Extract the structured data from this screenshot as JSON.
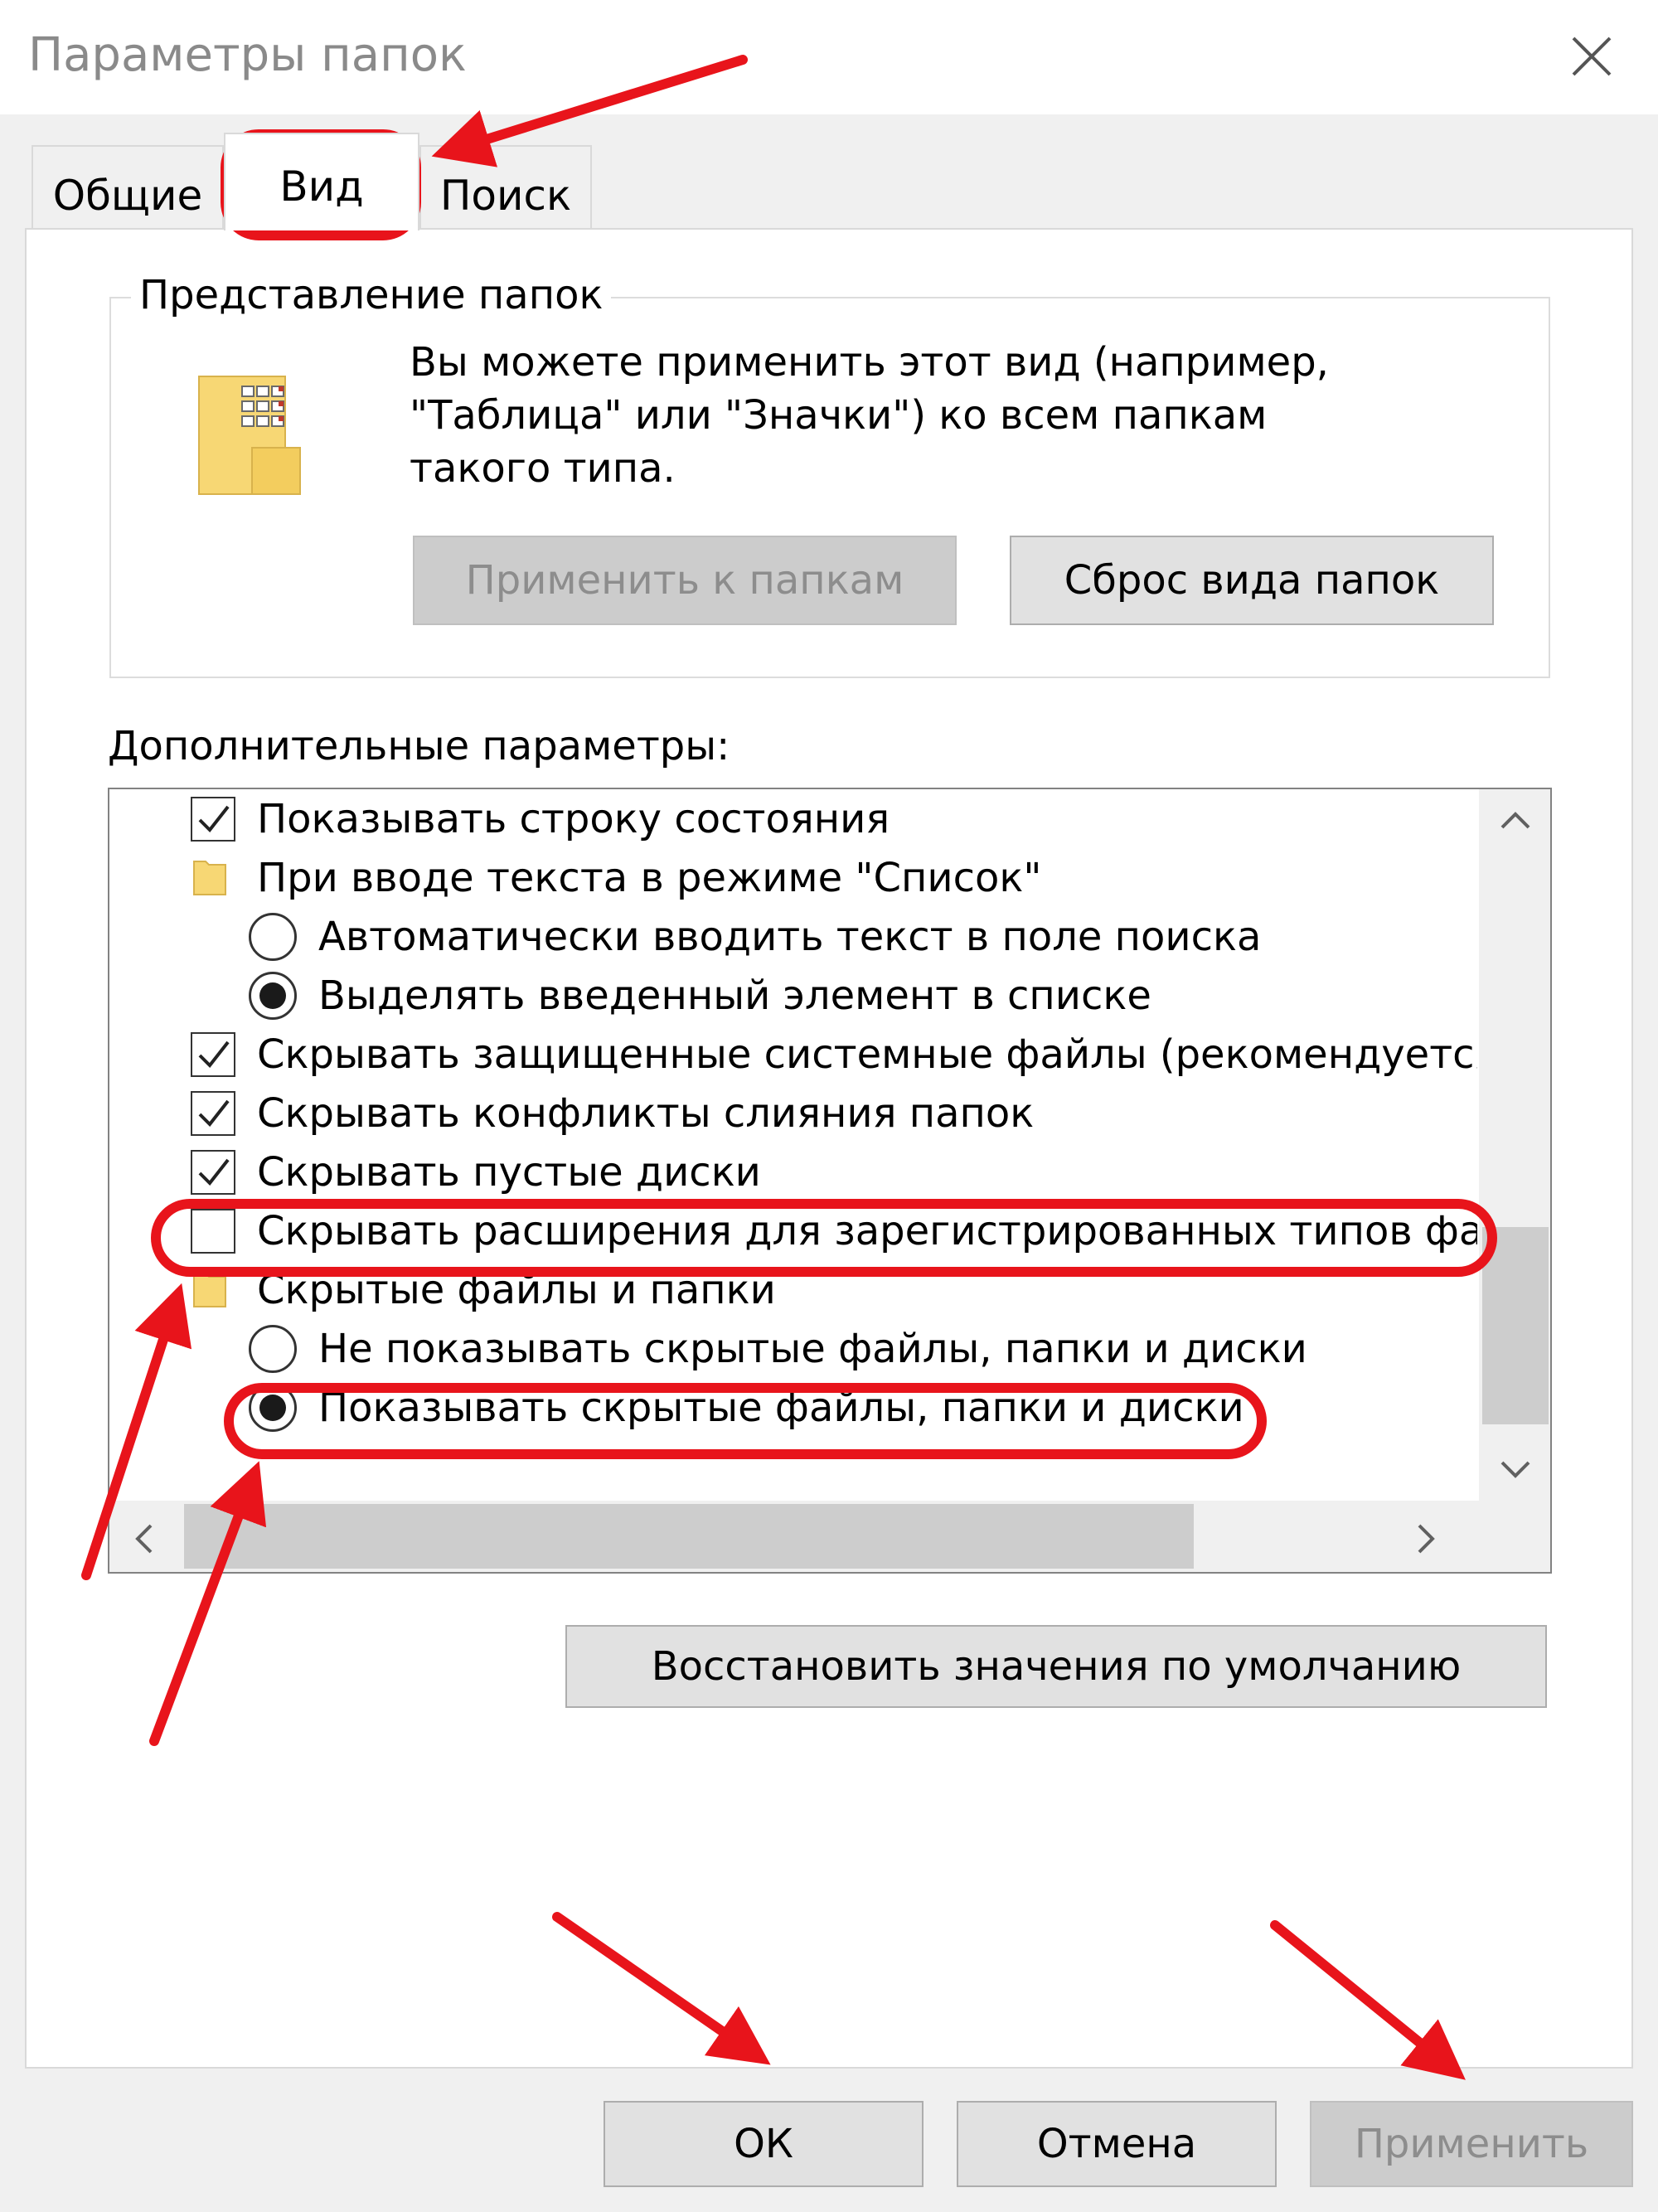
{
  "window": {
    "title": "Параметры папок",
    "close_icon": "close-icon"
  },
  "tabs": [
    {
      "label": "Общие"
    },
    {
      "label": "Вид"
    },
    {
      "label": "Поиск"
    }
  ],
  "folder_views": {
    "legend": "Представление папок",
    "description": "Вы можете применить этот вид (например,\n\"Таблица\" или \"Значки\") ко всем папкам\nтакого типа.",
    "apply_button": "Применить к папкам",
    "reset_button": "Сброс вида папок"
  },
  "advanced": {
    "label": "Дополнительные параметры:",
    "items": [
      {
        "type": "checkbox",
        "checked": true,
        "label": "Показывать строку состояния"
      },
      {
        "type": "folder",
        "label": "При вводе текста в режиме \"Список\""
      },
      {
        "type": "radio",
        "selected": false,
        "label": "Автоматически вводить текст в поле поиска"
      },
      {
        "type": "radio",
        "selected": true,
        "label": "Выделять введенный элемент в списке"
      },
      {
        "type": "checkbox",
        "checked": true,
        "label": "Скрывать защищенные системные файлы (рекомендуется"
      },
      {
        "type": "checkbox",
        "checked": true,
        "label": "Скрывать конфликты слияния папок"
      },
      {
        "type": "checkbox",
        "checked": true,
        "label": "Скрывать пустые диски"
      },
      {
        "type": "checkbox",
        "checked": false,
        "label": "Скрывать расширения для зарегистрированных типов файлов"
      },
      {
        "type": "folder",
        "label": "Скрытые файлы и папки"
      },
      {
        "type": "radio",
        "selected": false,
        "label": "Не показывать скрытые файлы, папки и диски"
      },
      {
        "type": "radio",
        "selected": true,
        "label": "Показывать скрытые файлы, папки и диски"
      }
    ],
    "restore_button": "Восстановить значения по умолчанию"
  },
  "footer": {
    "ok": "ОК",
    "cancel": "Отмена",
    "apply": "Применить"
  },
  "colors": {
    "annotation_red": "#e8141b",
    "window_bg": "#f0f0f0",
    "panel_bg": "#ffffff"
  }
}
